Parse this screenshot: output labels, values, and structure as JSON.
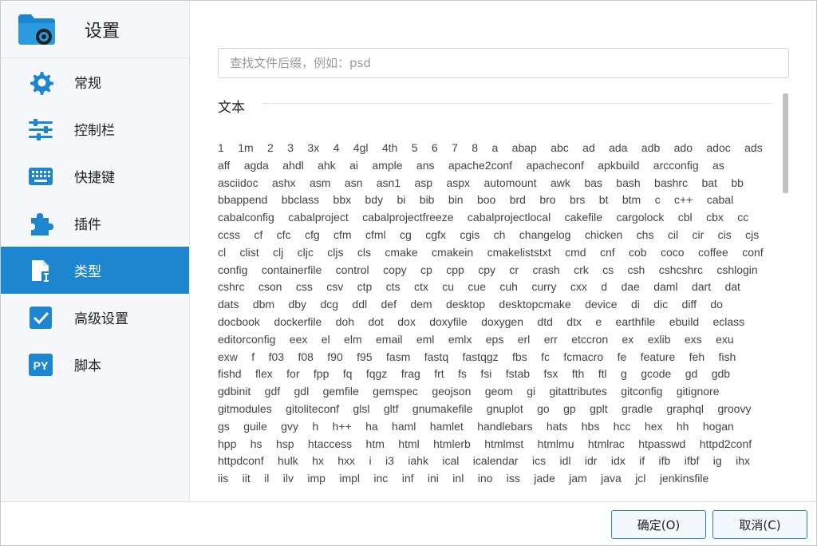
{
  "window": {
    "title": "设置"
  },
  "sidebar": {
    "items": [
      {
        "label": "常规",
        "icon": "gear-icon"
      },
      {
        "label": "控制栏",
        "icon": "sliders-icon"
      },
      {
        "label": "快捷键",
        "icon": "keyboard-icon"
      },
      {
        "label": "插件",
        "icon": "puzzle-icon"
      },
      {
        "label": "类型",
        "icon": "file-type-icon",
        "active": true
      },
      {
        "label": "高级设置",
        "icon": "checkbox-icon"
      },
      {
        "label": "脚本",
        "icon": "python-icon"
      }
    ]
  },
  "search": {
    "placeholder": "查找文件后缀，例如：psd",
    "value": ""
  },
  "section": {
    "title": "文本"
  },
  "extensions": [
    "1",
    "1m",
    "2",
    "3",
    "3x",
    "4",
    "4gl",
    "4th",
    "5",
    "6",
    "7",
    "8",
    "a",
    "abap",
    "abc",
    "ad",
    "ada",
    "adb",
    "ado",
    "adoc",
    "ads",
    "aff",
    "agda",
    "ahdl",
    "ahk",
    "ai",
    "ample",
    "ans",
    "apache2conf",
    "apacheconf",
    "apkbuild",
    "arcconfig",
    "as",
    "asciidoc",
    "ashx",
    "asm",
    "asn",
    "asn1",
    "asp",
    "aspx",
    "automount",
    "awk",
    "bas",
    "bash",
    "bashrc",
    "bat",
    "bb",
    "bbappend",
    "bbclass",
    "bbx",
    "bdy",
    "bi",
    "bib",
    "bin",
    "boo",
    "brd",
    "bro",
    "brs",
    "bt",
    "btm",
    "c",
    "c++",
    "cabal",
    "cabalconfig",
    "cabalproject",
    "cabalprojectfreeze",
    "cabalprojectlocal",
    "cakefile",
    "cargolock",
    "cbl",
    "cbx",
    "cc",
    "ccss",
    "cf",
    "cfc",
    "cfg",
    "cfm",
    "cfml",
    "cg",
    "cgfx",
    "cgis",
    "ch",
    "changelog",
    "chicken",
    "chs",
    "cil",
    "cir",
    "cis",
    "cjs",
    "cl",
    "clist",
    "clj",
    "cljc",
    "cljs",
    "cls",
    "cmake",
    "cmakein",
    "cmakeliststxt",
    "cmd",
    "cnf",
    "cob",
    "coco",
    "coffee",
    "conf",
    "config",
    "containerfile",
    "control",
    "copy",
    "cp",
    "cpp",
    "cpy",
    "cr",
    "crash",
    "crk",
    "cs",
    "csh",
    "cshcshrc",
    "cshlogin",
    "cshrc",
    "cson",
    "css",
    "csv",
    "ctp",
    "cts",
    "ctx",
    "cu",
    "cue",
    "cuh",
    "curry",
    "cxx",
    "d",
    "dae",
    "daml",
    "dart",
    "dat",
    "dats",
    "dbm",
    "dby",
    "dcg",
    "ddl",
    "def",
    "dem",
    "desktop",
    "desktopcmake",
    "device",
    "di",
    "dic",
    "diff",
    "do",
    "docbook",
    "dockerfile",
    "doh",
    "dot",
    "dox",
    "doxyfile",
    "doxygen",
    "dtd",
    "dtx",
    "e",
    "earthfile",
    "ebuild",
    "eclass",
    "editorconfig",
    "eex",
    "el",
    "elm",
    "email",
    "eml",
    "emlx",
    "eps",
    "erl",
    "err",
    "etccron",
    "ex",
    "exlib",
    "exs",
    "exu",
    "exw",
    "f",
    "f03",
    "f08",
    "f90",
    "f95",
    "fasm",
    "fastq",
    "fastqgz",
    "fbs",
    "fc",
    "fcmacro",
    "fe",
    "feature",
    "feh",
    "fish",
    "fishd",
    "flex",
    "for",
    "fpp",
    "fq",
    "fqgz",
    "frag",
    "frt",
    "fs",
    "fsi",
    "fstab",
    "fsx",
    "fth",
    "ftl",
    "g",
    "gcode",
    "gd",
    "gdb",
    "gdbinit",
    "gdf",
    "gdl",
    "gemfile",
    "gemspec",
    "geojson",
    "geom",
    "gi",
    "gitattributes",
    "gitconfig",
    "gitignore",
    "gitmodules",
    "gitoliteconf",
    "glsl",
    "gltf",
    "gnumakefile",
    "gnuplot",
    "go",
    "gp",
    "gplt",
    "gradle",
    "graphql",
    "groovy",
    "gs",
    "guile",
    "gvy",
    "h",
    "h++",
    "ha",
    "haml",
    "hamlet",
    "handlebars",
    "hats",
    "hbs",
    "hcc",
    "hex",
    "hh",
    "hogan",
    "hpp",
    "hs",
    "hsp",
    "htaccess",
    "htm",
    "html",
    "htmlerb",
    "htmlmst",
    "htmlmu",
    "htmlrac",
    "htpasswd",
    "httpd2conf",
    "httpdconf",
    "hulk",
    "hx",
    "hxx",
    "i",
    "i3",
    "iahk",
    "ical",
    "icalendar",
    "ics",
    "idl",
    "idr",
    "idx",
    "if",
    "ifb",
    "ifbf",
    "ig",
    "ihx",
    "iis",
    "iit",
    "il",
    "ilv",
    "imp",
    "impl",
    "inc",
    "inf",
    "ini",
    "inl",
    "ino",
    "iss",
    "jade",
    "jam",
    "java",
    "jcl",
    "jenkinsfile"
  ],
  "footer": {
    "ok_label": "确定(O)",
    "cancel_label": "取消(C)"
  },
  "colors": {
    "accent": "#1c87d0",
    "sidebar_bg": "#f5f7fa"
  }
}
